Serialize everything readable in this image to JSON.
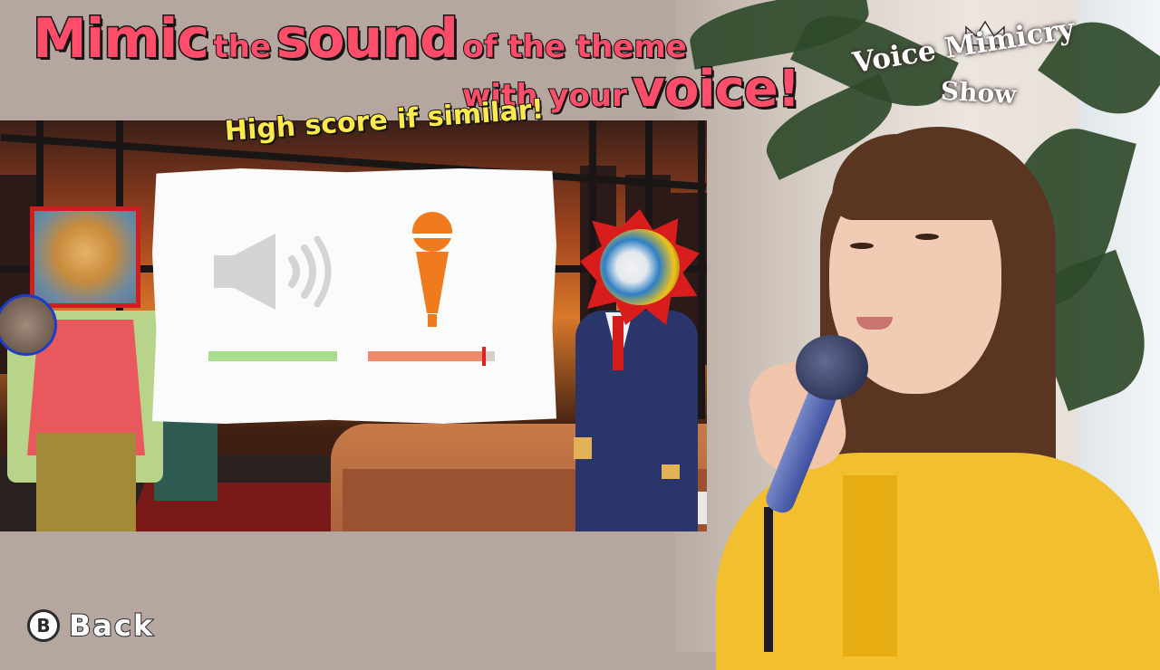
{
  "headline": {
    "line1": [
      {
        "text": "Mimic",
        "size": "big"
      },
      {
        "text": "the",
        "size": "small"
      },
      {
        "text": "sound",
        "size": "big"
      },
      {
        "text": "of the theme",
        "size": "small"
      }
    ],
    "line2": [
      {
        "text": "with your",
        "size": "small"
      },
      {
        "text": "voice!",
        "size": "big"
      }
    ]
  },
  "subtitle": "High score if similar!",
  "logo": {
    "line1": "Voice Mimicry",
    "line2": "Show",
    "icon": "crown-icon"
  },
  "panel": {
    "reference_icon": "speaker-icon",
    "player_icon": "microphone-icon",
    "reference_level": 1.0,
    "player_level": 0.93,
    "colors": {
      "reference_bar": "#a7dd8d",
      "player_bar": "#ee8a6c",
      "marker": "#e02020",
      "speaker": "#d4d4d4",
      "microphone": "#f07a1e"
    }
  },
  "controls": {
    "back_button_glyph": "B",
    "back_label": "Back"
  },
  "colors": {
    "headline_accent": "#ff4d6a",
    "subtitle": "#ffe94d",
    "background": "#b5a79f"
  }
}
